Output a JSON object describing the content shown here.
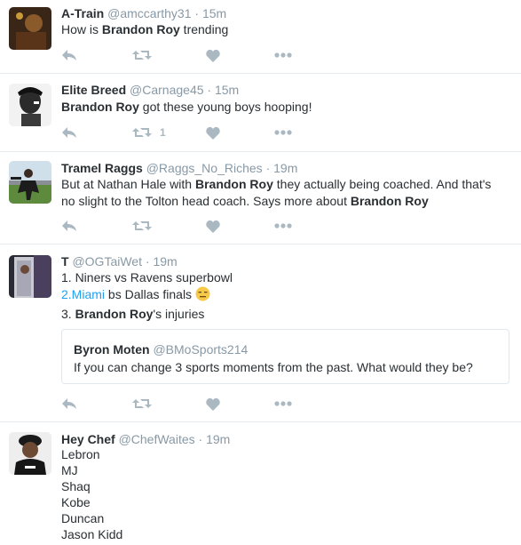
{
  "tweets": [
    {
      "name": "A-Train",
      "handle": "@amccarthy31",
      "dot": "·",
      "time": "15m",
      "body": {
        "t1": "How is ",
        "b1": "Brandon Roy",
        "t2": " trending"
      },
      "retweet_count": "",
      "like_count": ""
    },
    {
      "name": "Elite Breed",
      "handle": "@Carnage45",
      "dot": "·",
      "time": "15m",
      "body": {
        "b1": "Brandon Roy",
        "t1": " got these young boys hooping!"
      },
      "retweet_count": "1",
      "like_count": ""
    },
    {
      "name": "Tramel Raggs",
      "handle": "@Raggs_No_Riches",
      "dot": "·",
      "time": "19m",
      "body": {
        "t1": "But at Nathan Hale with ",
        "b1": "Brandon Roy",
        "t2": " they actually being coached. And that's",
        "t3": "no slight to the Tolton head coach. Says more about ",
        "b2": "Brandon Roy"
      },
      "retweet_count": "",
      "like_count": ""
    },
    {
      "name": "T",
      "handle": "@OGTaiWet",
      "dot": "·",
      "time": "19m",
      "lines": {
        "l1": "1. Niners vs Ravens superbowl",
        "l2_link": "2.Miami",
        "l2_rest": " bs Dallas finals ",
        "l2_emoji": "😑",
        "l3_num": "3. ",
        "l3_bold": "Brandon Roy",
        "l3_rest": "'s injuries"
      },
      "quote": {
        "name": "Byron Moten",
        "handle": "@BMoSports214",
        "text": "If you can change 3 sports moments from the past. What would they be?"
      },
      "retweet_count": "",
      "like_count": ""
    },
    {
      "name": "Hey Chef",
      "handle": "@ChefWaites",
      "dot": "·",
      "time": "19m",
      "list": [
        "Lebron",
        "MJ",
        "Shaq",
        "Kobe",
        "Duncan",
        "Jason Kidd"
      ]
    }
  ],
  "icons": {
    "reply": "reply-icon",
    "retweet": "retweet-icon",
    "like": "heart-icon",
    "more": "more-dots-icon"
  },
  "colors": {
    "text": "#292f33",
    "muted": "#8899a6",
    "action": "#aab8c2",
    "link": "#1da1f2",
    "divider": "#e6ecf0"
  }
}
